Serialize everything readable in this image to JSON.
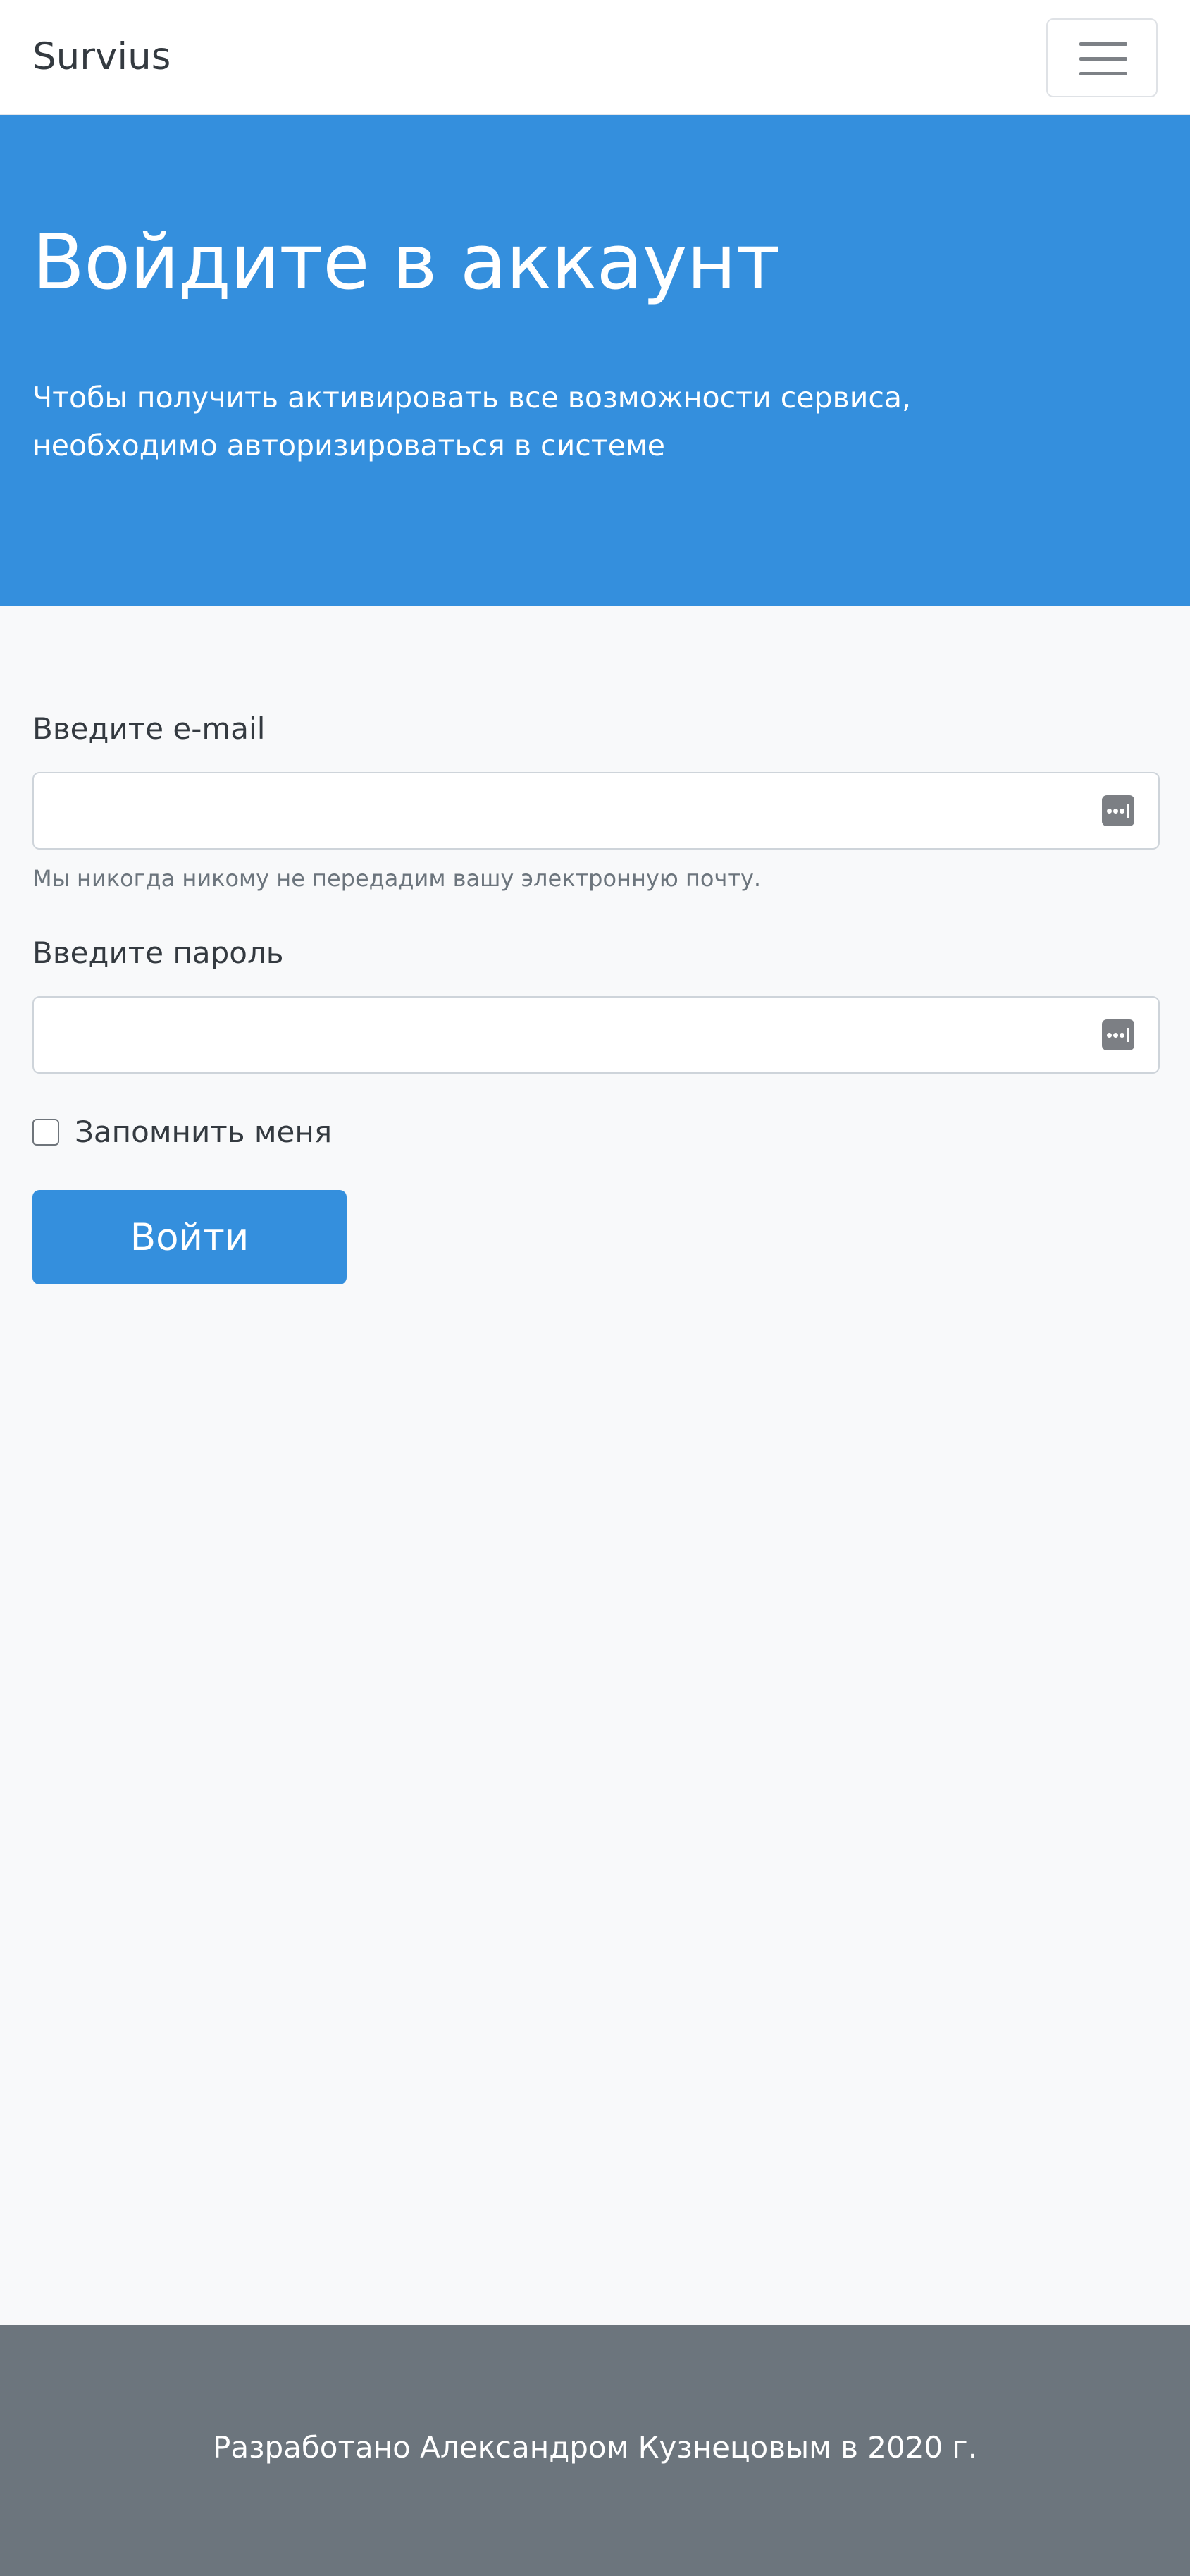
{
  "navbar": {
    "brand": "Survius",
    "toggler_icon": "hamburger-menu-icon"
  },
  "hero": {
    "title": "Войдите в аккаунт",
    "lead": "Чтобы получить активировать все возможности сервиса, необходимо авторизироваться в системе"
  },
  "form": {
    "email_label": "Введите e-mail",
    "email_value": "",
    "email_help": "Мы никогда никому не передадим вашу электронную почту.",
    "password_label": "Введите пароль",
    "password_value": "",
    "field_icon": "password-manager-key-icon",
    "remember_label": "Запомнить меня",
    "remember_checked": false,
    "submit_label": "Войти"
  },
  "footer": {
    "text": "Разработано Александром Кузнецовым в 2020 г."
  },
  "colors": {
    "primary": "#348fdd",
    "footer_bg": "#6c757d",
    "page_bg": "#f8f9fa"
  }
}
